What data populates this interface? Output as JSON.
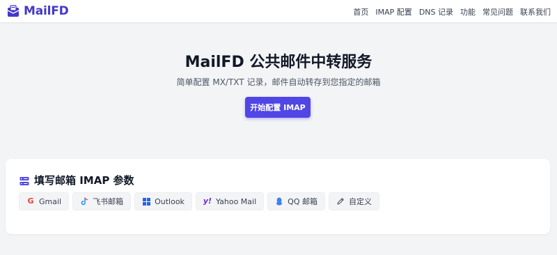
{
  "brand": {
    "name": "MailFD",
    "color": "#4338ca"
  },
  "nav": {
    "items": [
      {
        "label": "首页"
      },
      {
        "label": "IMAP 配置"
      },
      {
        "label": "DNS 记录"
      },
      {
        "label": "功能"
      },
      {
        "label": "常见问题"
      },
      {
        "label": "联系我们"
      }
    ]
  },
  "hero": {
    "title": "MailFD 公共邮件中转服务",
    "subtitle": "简单配置 MX/TXT 记录，邮件自动转存到您指定的邮箱",
    "cta_label": "开始配置 IMAP",
    "cta_color": "#4f46e5"
  },
  "imap_card": {
    "title": "填写邮箱 IMAP 参数",
    "icon": "server-icon",
    "presets": [
      {
        "label": "Gmail",
        "icon": "google-icon",
        "color": "#ea4335"
      },
      {
        "label": "飞书邮箱",
        "icon": "feishu-icon",
        "color": "#1a8fe8"
      },
      {
        "label": "Outlook",
        "icon": "windows-icon",
        "color": "#2563eb"
      },
      {
        "label": "Yahoo Mail",
        "icon": "yahoo-icon",
        "color": "#6d28d9"
      },
      {
        "label": "QQ 邮箱",
        "icon": "qq-icon",
        "color": "#3b82f6"
      },
      {
        "label": "自定义",
        "icon": "pencil-icon",
        "color": "#4b5563"
      }
    ]
  }
}
